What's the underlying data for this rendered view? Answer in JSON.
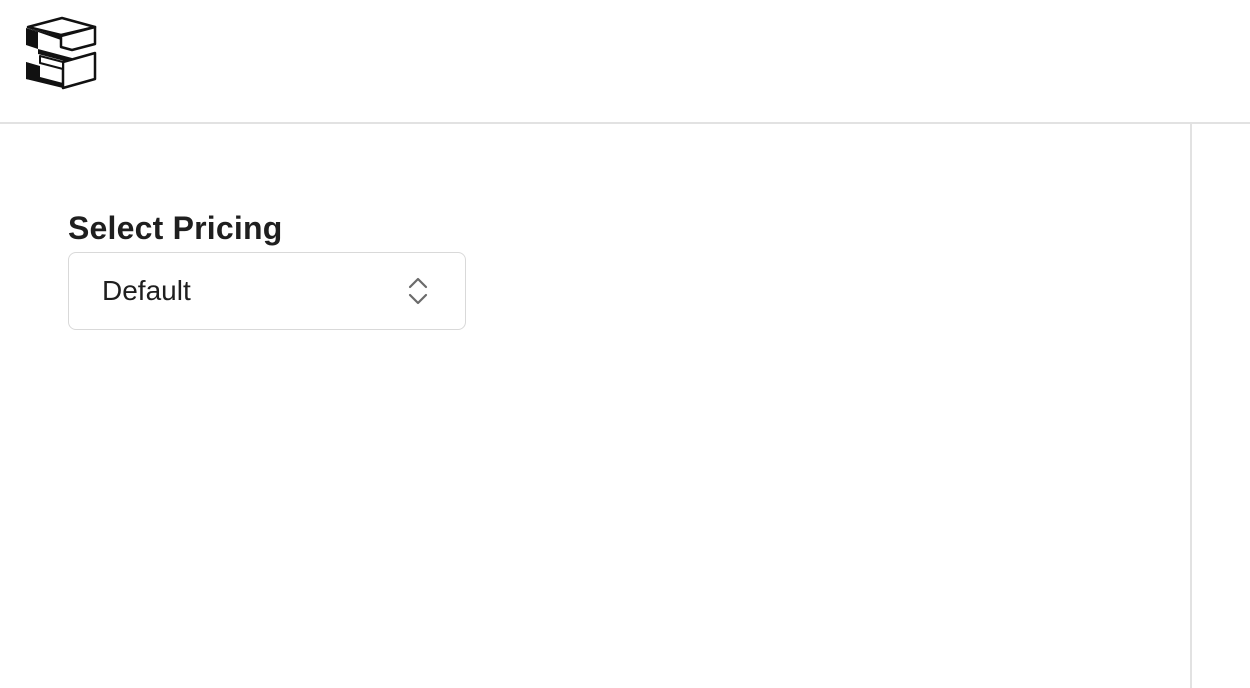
{
  "header": {
    "logo_icon": "stacked-cube-logo-icon"
  },
  "pricing": {
    "title": "Select Pricing",
    "selected_value": "Default",
    "chevron_icon": "up-down-chevron-icon"
  },
  "colors": {
    "text": "#1f1f1f",
    "border": "#d9d9d9",
    "divider": "#e2e2e2",
    "background": "#ffffff"
  }
}
